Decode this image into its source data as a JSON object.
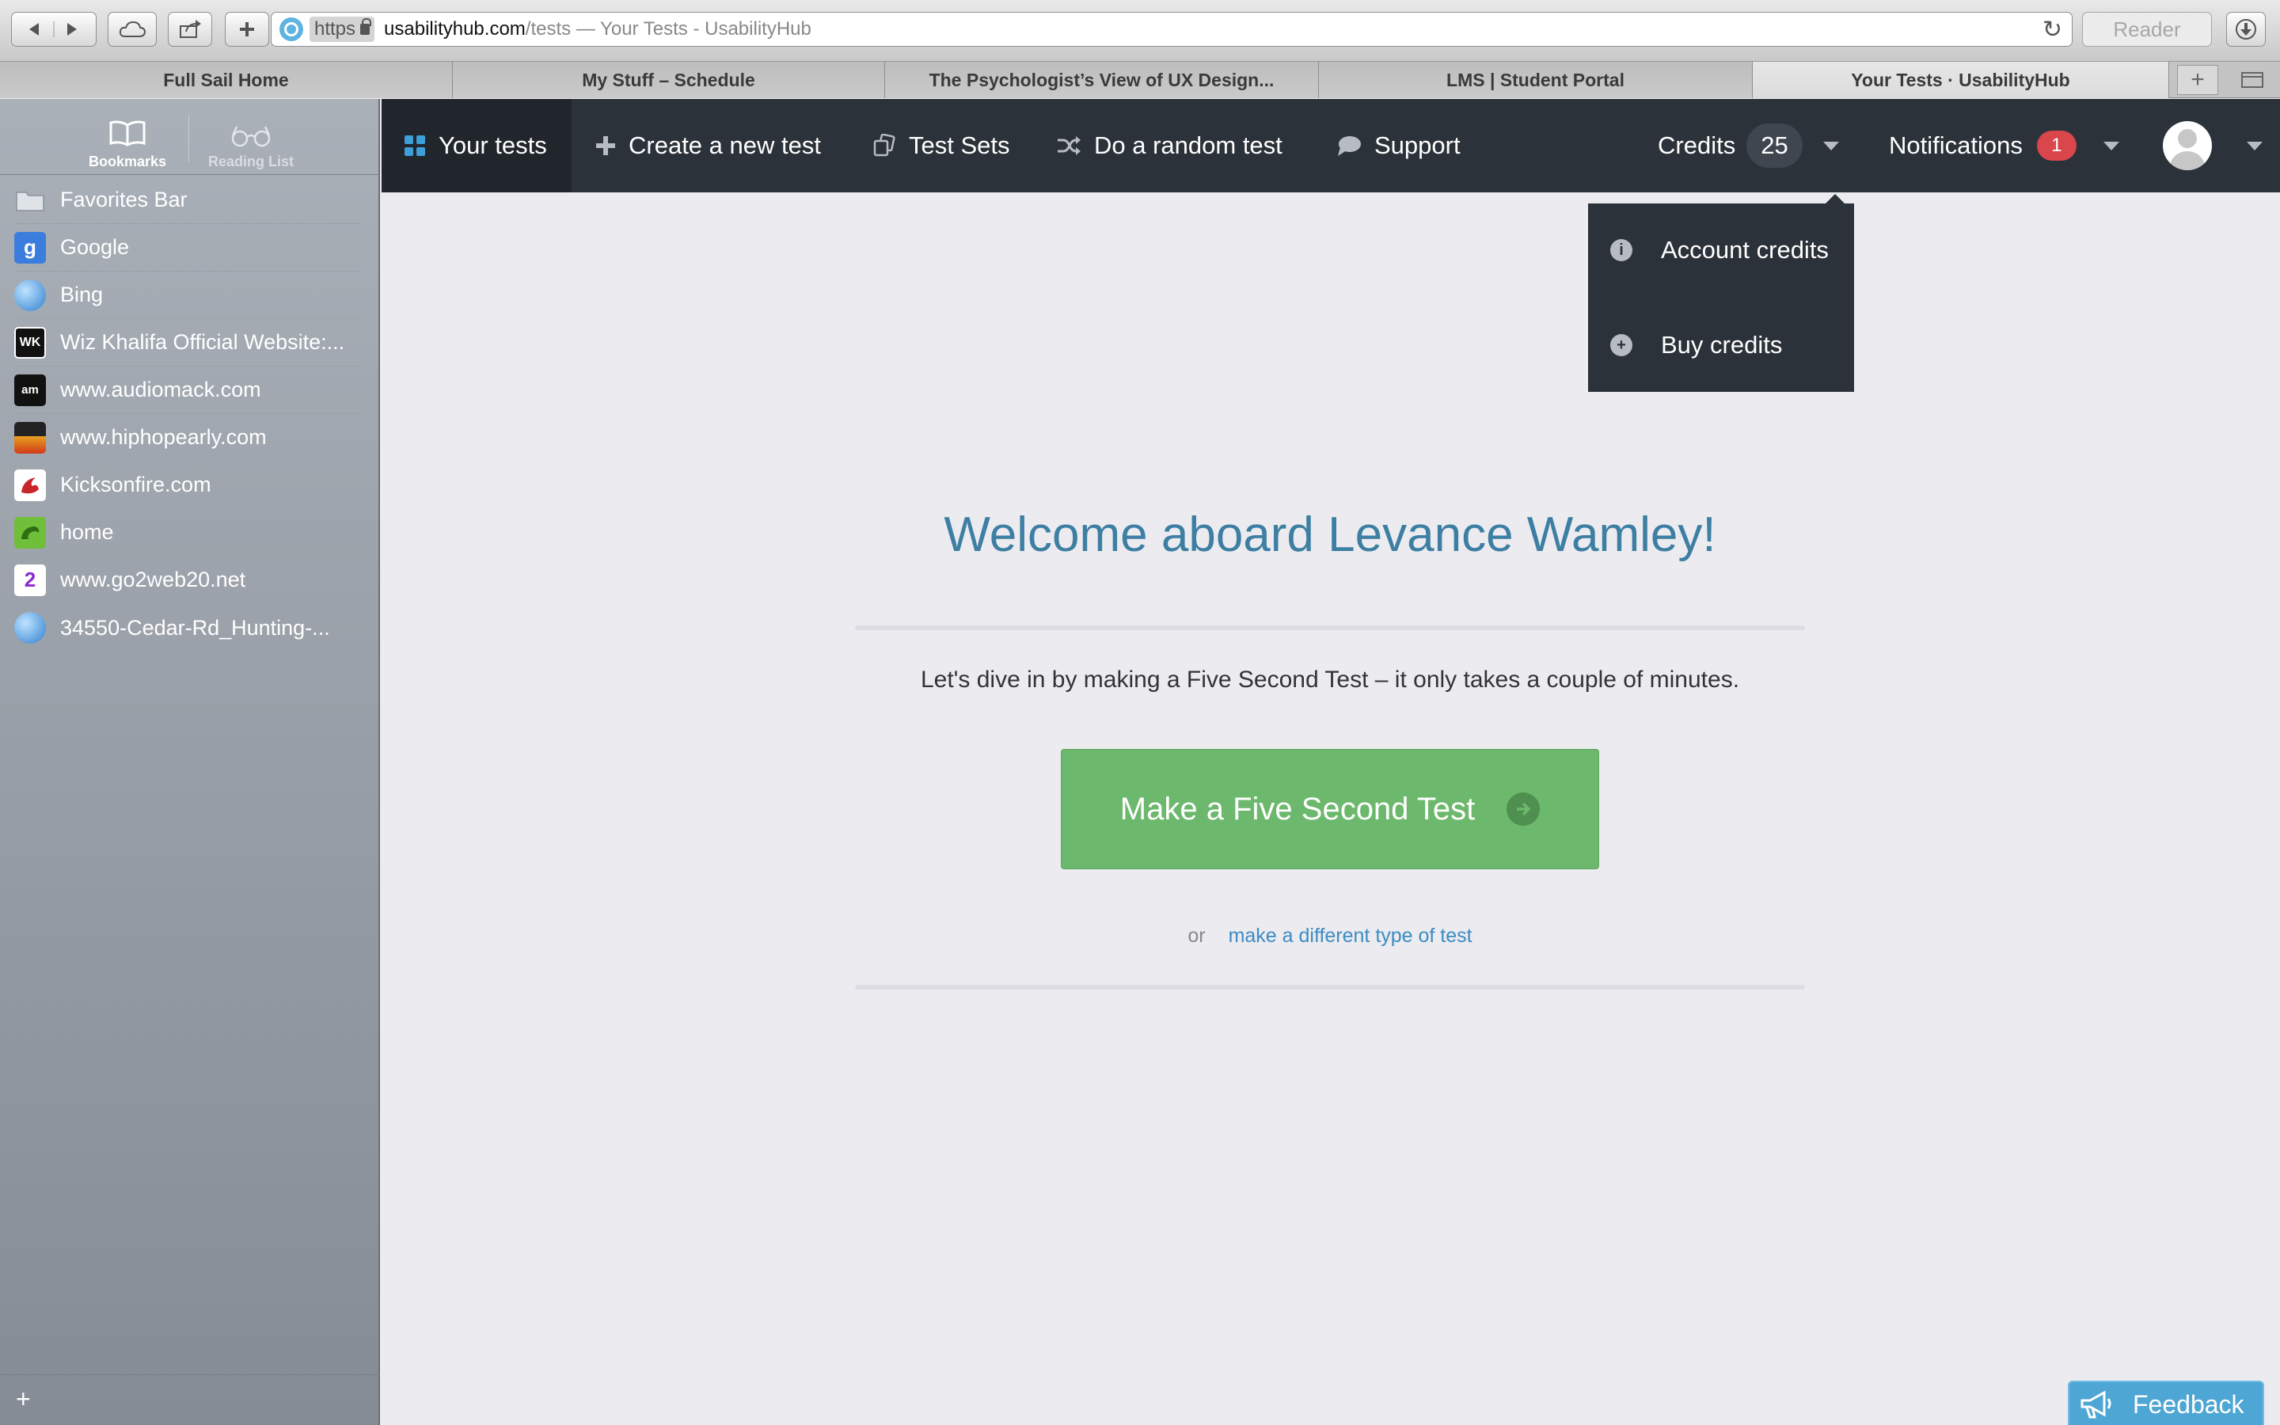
{
  "browser": {
    "address": {
      "scheme": "https",
      "domain": "usabilityhub.com",
      "path": "/tests — Your Tests - UsabilityHub"
    },
    "reader_label": "Reader",
    "tabs": [
      {
        "label": "Full Sail Home"
      },
      {
        "label": "My Stuff – Schedule"
      },
      {
        "label": "The Psychologist’s View of UX Design..."
      },
      {
        "label": "LMS | Student Portal"
      },
      {
        "label": "Your Tests · UsabilityHub"
      }
    ]
  },
  "sidebar": {
    "bookmarks_label": "Bookmarks",
    "reading_list_label": "Reading List",
    "items": [
      {
        "label": "Favorites Bar",
        "icon": "folder-icon"
      },
      {
        "label": "Google",
        "icon": "google-icon"
      },
      {
        "label": "Bing",
        "icon": "globe-icon"
      },
      {
        "label": "Wiz Khalifa Official Website:...",
        "icon": "wk-icon"
      },
      {
        "label": "www.audiomack.com",
        "icon": "audiomack-icon"
      },
      {
        "label": "www.hiphopearly.com",
        "icon": "hiphopearly-icon"
      },
      {
        "label": "Kicksonfire.com",
        "icon": "kicksonfire-icon"
      },
      {
        "label": "home",
        "icon": "home-icon"
      },
      {
        "label": "www.go2web20.net",
        "icon": "go2web-icon"
      },
      {
        "label": "34550-Cedar-Rd_Hunting-...",
        "icon": "globe-icon"
      }
    ]
  },
  "nav": {
    "your_tests": "Your tests",
    "create_test": "Create a new test",
    "test_sets": "Test Sets",
    "random_test": "Do a random test",
    "support": "Support",
    "credits_label": "Credits",
    "credits_value": "25",
    "notifications_label": "Notifications",
    "notifications_count": "1"
  },
  "credits_menu": {
    "account_credits": "Account credits",
    "buy_credits": "Buy credits"
  },
  "main": {
    "welcome": "Welcome aboard Levance Wamley!",
    "intro": "Let's dive in by making a Five Second Test – it only takes a couple of minutes.",
    "cta_label": "Make a Five Second Test",
    "alt_or": "or",
    "alt_link": "make a different type of test"
  },
  "feedback_label": "Feedback",
  "colors": {
    "nav_bg": "#2c323a",
    "welcome_text": "#3d7fa3",
    "cta_green": "#6cb86c",
    "badge_red": "#d9464b",
    "link_blue": "#3c8cc3",
    "feedback_blue": "#4ea6d4"
  }
}
